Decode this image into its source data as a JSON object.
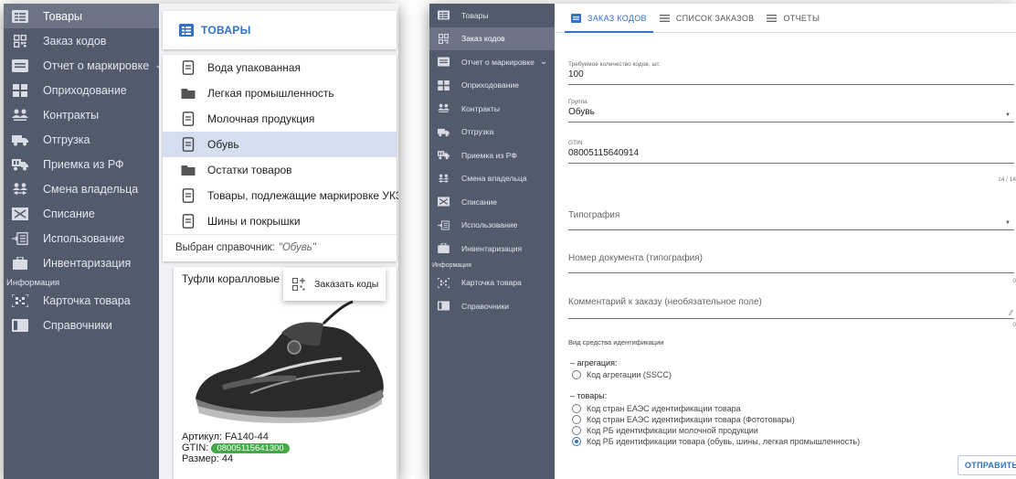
{
  "left": {
    "sidebar": {
      "items": [
        {
          "label": "Товары",
          "icon": "catalog-icon",
          "active": true
        },
        {
          "label": "Заказ кодов",
          "icon": "qr-code-icon"
        },
        {
          "label": "Отчет о маркировке",
          "icon": "report-icon",
          "chevron": "⌄"
        },
        {
          "label": "Оприходование",
          "icon": "receive-goods-icon"
        },
        {
          "label": "Контракты",
          "icon": "contract-people-icon"
        },
        {
          "label": "Отгрузка",
          "icon": "truck-icon"
        },
        {
          "label": "Приемка из РФ",
          "icon": "delivery-truck-icon"
        },
        {
          "label": "Смена владельца",
          "icon": "owner-change-icon"
        },
        {
          "label": "Списание",
          "icon": "write-off-icon"
        },
        {
          "label": "Использование",
          "icon": "usage-icon"
        },
        {
          "label": "Инвентаризация",
          "icon": "inventory-icon"
        }
      ],
      "section": "Информация",
      "info_items": [
        {
          "label": "Карточка товара",
          "icon": "product-card-icon"
        },
        {
          "label": "Справочники",
          "icon": "directory-icon"
        }
      ]
    },
    "header": {
      "title": "ТОВАРЫ",
      "icon": "catalog-icon"
    },
    "directory": {
      "items": [
        {
          "label": "Вода упакованная",
          "type": "file"
        },
        {
          "label": "Легкая промышленность",
          "type": "folder"
        },
        {
          "label": "Молочная продукция",
          "type": "file"
        },
        {
          "label": "Обувь",
          "type": "file",
          "selected": true
        },
        {
          "label": "Остатки товаров",
          "type": "folder"
        },
        {
          "label": "Товары, подлежащие маркировке УКЗ",
          "type": "file"
        },
        {
          "label": "Шины и покрышки",
          "type": "file"
        }
      ],
      "footer_prefix": "Выбран справочник:",
      "footer_value": "\"Обувь\""
    },
    "product": {
      "title": "Туфли коралловые",
      "order_button": "Заказать коды",
      "article": "Артикул: FA140-44",
      "gtin_label": "GTIN:",
      "gtin": "08005115641300",
      "size": "Размер: 44"
    }
  },
  "right": {
    "sidebar": {
      "items": [
        {
          "label": "Товары",
          "icon": "catalog-icon"
        },
        {
          "label": "Заказ кодов",
          "icon": "qr-code-icon",
          "active": true
        },
        {
          "label": "Отчет о маркировке",
          "icon": "report-icon",
          "chevron": "⌄"
        },
        {
          "label": "Оприходование",
          "icon": "receive-goods-icon"
        },
        {
          "label": "Контракты",
          "icon": "contract-people-icon"
        },
        {
          "label": "Отгрузка",
          "icon": "truck-icon"
        },
        {
          "label": "Приемка из РФ",
          "icon": "delivery-truck-icon"
        },
        {
          "label": "Смена владельца",
          "icon": "owner-change-icon"
        },
        {
          "label": "Списание",
          "icon": "write-off-icon"
        },
        {
          "label": "Использование",
          "icon": "usage-icon"
        },
        {
          "label": "Инвентаризация",
          "icon": "inventory-icon"
        }
      ],
      "section": "Информация",
      "info_items": [
        {
          "label": "Карточка товара",
          "icon": "product-card-icon"
        },
        {
          "label": "Справочники",
          "icon": "directory-icon"
        }
      ]
    },
    "tabs": [
      {
        "label": "ЗАКАЗ КОДОВ",
        "icon": "document-icon",
        "active": true
      },
      {
        "label": "СПИСОК ЗАКАЗОВ",
        "icon": "list-icon"
      },
      {
        "label": "ОТЧЕТЫ",
        "icon": "list-icon"
      }
    ],
    "form": {
      "qty_label": "Требуемое количество кодов, шт.",
      "qty_value": "100",
      "group_label": "Группа",
      "group_value": "Обувь",
      "gtin_label": "GTIN",
      "gtin_value": "08005115640914",
      "gtin_counter": "14 / 14",
      "printer_placeholder": "Типография",
      "docnum_placeholder": "Номер документа (типография)",
      "docnum_counter": "0",
      "comment_placeholder": "Комментарий к заказу (необязательное поле)",
      "comment_counter": "0",
      "id_type_title": "Вид средства идентификации",
      "agg_header": "– агрегация:",
      "agg_options": [
        {
          "label": "Код агрегации (SSCC)"
        }
      ],
      "goods_header": "– товары:",
      "goods_options": [
        {
          "label": "Код стран ЕАЭС идентификации товара"
        },
        {
          "label": "Код стран ЕАЭС идентификации товара (Фототовары)"
        },
        {
          "label": "Код РБ идентификации молочной продукции"
        },
        {
          "label": "Код РБ идентификации товара (обувь, шины, легкая промышленность)",
          "checked": true
        }
      ],
      "submit": "ОТПРАВИТЬ"
    }
  }
}
